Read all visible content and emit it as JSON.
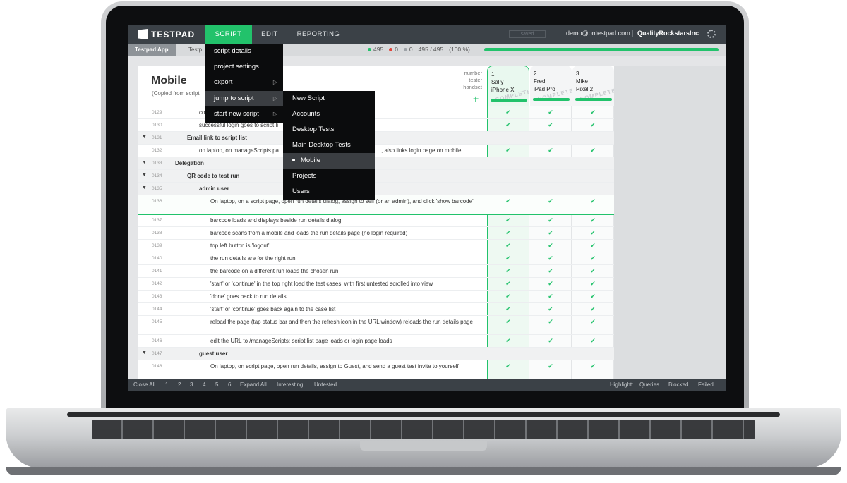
{
  "app": {
    "logo": "TESTPAD",
    "nav": [
      "SCRIPT",
      "EDIT",
      "REPORTING"
    ],
    "saved": "saved",
    "user_email": "demo@ontestpad.com",
    "org": "QualityRockstarsInc"
  },
  "subbar": {
    "crumb_project": "Testpad App",
    "crumb_folder": "Testp",
    "pass_count": "495",
    "fail_count": "0",
    "untested_count": "0",
    "ratio": "495 / 495",
    "percent": "(100 %)",
    "progress_fraction": 1.0
  },
  "script": {
    "title": "Mobile",
    "subtitle": "(Copied from script",
    "meta_labels": [
      "number",
      "tester",
      "handset"
    ]
  },
  "runs": [
    {
      "number": "1",
      "tester": "Sally",
      "handset": "iPhone X",
      "status": "COMPLETE"
    },
    {
      "number": "2",
      "tester": "Fred",
      "handset": "iPad Pro",
      "status": "COMPLETE"
    },
    {
      "number": "3",
      "tester": "Mike",
      "handset": "Pixel 2",
      "status": "COMPLETE"
    }
  ],
  "rows": [
    {
      "num": "0129",
      "text": "co",
      "indent": 4,
      "section": false,
      "checks": true
    },
    {
      "num": "0130",
      "text": "successful login goes to script li",
      "indent": 4,
      "section": false,
      "checks": true
    },
    {
      "num": "0131",
      "text": "Email link to script list",
      "indent": 3,
      "section": true,
      "checks": false
    },
    {
      "num": "0132",
      "text": "on laptop, on manageScripts pa",
      "tail": ", also links login page on mobile",
      "indent": 4,
      "section": false,
      "checks": true
    },
    {
      "num": "0133",
      "text": "Delegation",
      "indent": 2,
      "section": true,
      "checks": false
    },
    {
      "num": "0134",
      "text": "QR code to test run",
      "indent": 3,
      "section": true,
      "checks": false
    },
    {
      "num": "0135",
      "text": "admin user",
      "indent": 4,
      "section": true,
      "checks": false
    },
    {
      "num": "0136",
      "text": "On laptop, on a script page, open run details dialog, assign to self (or an admin), and click 'show barcode'",
      "indent": 5,
      "section": false,
      "checks": true,
      "highlight": true,
      "tall": true
    },
    {
      "num": "0137",
      "text": "barcode loads and displays beside run details dialog",
      "indent": 5,
      "section": false,
      "checks": true
    },
    {
      "num": "0138",
      "text": "barcode scans from a mobile and loads the run details page (no login required)",
      "indent": 5,
      "section": false,
      "checks": true
    },
    {
      "num": "0139",
      "text": "top left button is 'logout'",
      "indent": 5,
      "section": false,
      "checks": true
    },
    {
      "num": "0140",
      "text": "the run details are for the right run",
      "indent": 5,
      "section": false,
      "checks": true
    },
    {
      "num": "0141",
      "text": "the barcode on a different run loads the chosen run",
      "indent": 5,
      "section": false,
      "checks": true
    },
    {
      "num": "0142",
      "text": "'start' or 'continue' in the top right load the test cases, with first untested scrolled into view",
      "indent": 5,
      "section": false,
      "checks": true
    },
    {
      "num": "0143",
      "text": "'done' goes back to run details",
      "indent": 5,
      "section": false,
      "checks": true
    },
    {
      "num": "0144",
      "text": "'start' or 'continue' goes back again to the case list",
      "indent": 5,
      "section": false,
      "checks": true
    },
    {
      "num": "0145",
      "text": "reload the page (tap status bar and then the refresh icon in the URL window) reloads the run details page",
      "indent": 5,
      "section": false,
      "checks": true,
      "tall": true
    },
    {
      "num": "0146",
      "text": "edit the URL to /manageScripts; script list page loads or login page loads",
      "indent": 5,
      "section": false,
      "checks": true
    },
    {
      "num": "0147",
      "text": "guest user",
      "indent": 4,
      "section": true,
      "checks": false
    },
    {
      "num": "0148",
      "text": "On laptop, on script page, open run details, assign to Guest, and send a guest test invite to yourself",
      "indent": 5,
      "section": false,
      "checks": true,
      "tall": true
    }
  ],
  "script_menu": [
    {
      "label": "script details",
      "submenu": false
    },
    {
      "label": "project settings",
      "submenu": false
    },
    {
      "label": "export",
      "submenu": true
    },
    {
      "label": "jump to script",
      "submenu": true,
      "active": true
    },
    {
      "label": "start new script",
      "submenu": true
    }
  ],
  "jump_menu": [
    {
      "label": "New Script",
      "current": false
    },
    {
      "label": "Accounts",
      "current": false
    },
    {
      "label": "Desktop Tests",
      "current": false
    },
    {
      "label": "Main Desktop Tests",
      "current": false
    },
    {
      "label": "Mobile",
      "current": true
    },
    {
      "label": "Projects",
      "current": false
    },
    {
      "label": "Users",
      "current": false
    }
  ],
  "bottombar": {
    "close_all": "Close All",
    "levels": [
      "1",
      "2",
      "3",
      "4",
      "5",
      "6"
    ],
    "expand_all": "Expand All",
    "interesting": "Interesting",
    "untested": "Untested",
    "highlight_label": "Highlight:",
    "queries": "Queries",
    "blocked": "Blocked",
    "failed": "Failed"
  },
  "icons": {
    "check": "check-icon",
    "triangle": "triangle-down-icon",
    "gear": "gear-icon",
    "add": "plus-icon",
    "submenu": "chevron-right-icon"
  },
  "colors": {
    "accent": "#22c26b",
    "topbar": "#3b4147",
    "menu": "#0b0c0d"
  }
}
